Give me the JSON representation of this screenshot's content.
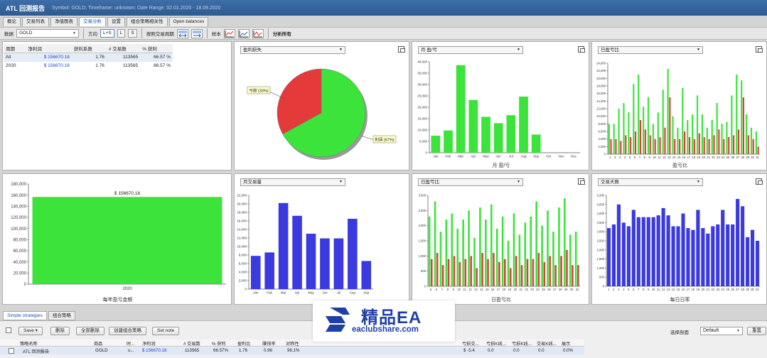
{
  "window": {
    "app_title": "ATL 回测报告",
    "subtitle": "Symbol: GOLD; Timeframe: unknown; Date Range: 02.01.2020 - 18.09.2020"
  },
  "tabs": [
    "概论",
    "交易列表",
    "净值图表",
    "交易分析",
    "设置",
    "组合策略相关性",
    "Open balances"
  ],
  "active_tab": "交易分析",
  "toolbar": {
    "data_label": "数据",
    "data_value": "GOLD",
    "direction_label": "方向",
    "direction_options": [
      "L+S",
      "L",
      "S"
    ],
    "by_period_label": "按照交易周期",
    "sample_label": "样本",
    "analysis_label": "分析所有"
  },
  "stats_table": {
    "headers": [
      "周期",
      "净利润",
      "获利系数",
      "# 交易数",
      "% 获利"
    ],
    "rows": [
      [
        "All",
        "$ 156670.18",
        "1.76",
        "113565",
        "66.57 %"
      ],
      [
        "2020",
        "$ 156670.18",
        "1.76",
        "113565",
        "66.57 %"
      ]
    ]
  },
  "panels": {
    "pie": {
      "selector": "盈利损失",
      "label_loss": "亏损 (33%)",
      "label_win": "利润 (67%)"
    },
    "monthly_profit": {
      "selector": "月 盈/亏",
      "title": "月 盈/亏"
    },
    "daily_profit_top": {
      "selector": "日盈亏比",
      "title": "盈亏比"
    },
    "yearly": {
      "value_label": "$ 156670.18",
      "title": "每年盈亏金额"
    },
    "monthly_trades": {
      "selector": "月交易量"
    },
    "daily_profit_bottom": {
      "selector": "日盈亏比",
      "title": "日盈亏比"
    },
    "trade_days": {
      "selector": "交易天数",
      "title": "每日日率"
    }
  },
  "chart_data": [
    {
      "type": "pie",
      "categories": [
        "亏损",
        "利润"
      ],
      "values": [
        33,
        67
      ],
      "colors": [
        "#e53a3a",
        "#3be33b"
      ]
    },
    {
      "type": "bar",
      "categories": [
        "Jan",
        "Feb",
        "Mar",
        "Apr",
        "May",
        "Jun",
        "Jul",
        "Aug",
        "Sep",
        "Oct",
        "Nov",
        "Dec"
      ],
      "values": [
        7500,
        9800,
        38500,
        23200,
        15800,
        13000,
        16500,
        24700,
        8000,
        0,
        0,
        0
      ],
      "ylim": [
        0,
        40000
      ],
      "yticks": [
        "0",
        "5,000",
        "10,000",
        "15,000",
        "20,000",
        "25,000",
        "30,000",
        "35,000",
        "40,000"
      ],
      "color": "#3be33b"
    },
    {
      "type": "bar",
      "categories": [
        "1",
        "2",
        "3",
        "4",
        "5",
        "6",
        "7",
        "8",
        "9",
        "10",
        "11",
        "12",
        "13",
        "14",
        "15",
        "16",
        "17",
        "18",
        "19",
        "20",
        "21",
        "22",
        "23",
        "24",
        "25",
        "26",
        "27",
        "28",
        "29",
        "30",
        "31"
      ],
      "series": [
        {
          "values": [
            8000,
            8000,
            12000,
            13500,
            11000,
            18500,
            21000,
            12500,
            15000,
            8000,
            11000,
            17000,
            22500,
            10000,
            7000,
            17500,
            9000,
            10500,
            15500,
            10500,
            7000,
            9000,
            13500,
            8000,
            8500,
            15500,
            21000,
            19500,
            10500,
            7000,
            6000
          ],
          "color": "#3be33b"
        },
        {
          "values": [
            4000,
            4000,
            3500,
            5000,
            4500,
            6000,
            9000,
            6500,
            5000,
            4000,
            4500,
            7000,
            15000,
            4000,
            4000,
            6000,
            4500,
            4000,
            5500,
            4500,
            4000,
            5000,
            6500,
            4000,
            4500,
            5000,
            6500,
            15000,
            5000,
            4000,
            2000
          ],
          "color": "#d84040"
        }
      ],
      "ylim": [
        0,
        24000
      ],
      "yticks": [
        "0",
        "2,000",
        "4,000",
        "6,000",
        "8,000",
        "10,000",
        "12,000",
        "14,000",
        "16,000",
        "18,000",
        "20,000",
        "22,000",
        "24,000"
      ]
    },
    {
      "type": "bar",
      "categories": [
        "2020"
      ],
      "values": [
        156670.18
      ],
      "ylim": [
        0,
        180000
      ],
      "yticks": [
        "0",
        "20,000",
        "40,000",
        "60,000",
        "80,000",
        "100,000",
        "120,000",
        "140,000",
        "160,000",
        "180,000"
      ],
      "color": "#3be33b"
    },
    {
      "type": "bar",
      "categories": [
        "Jan",
        "Feb",
        "Mar",
        "Apr",
        "May",
        "Jun",
        "Jul",
        "Aug",
        "Sep"
      ],
      "values": [
        7800,
        8600,
        20200,
        17200,
        13000,
        11900,
        11900,
        16500,
        6600
      ],
      "ylim": [
        0,
        22000
      ],
      "yticks": [
        "0",
        "2,000",
        "4,000",
        "6,000",
        "8,000",
        "10,000",
        "12,000",
        "14,000",
        "16,000",
        "18,000",
        "20,000",
        "22,000"
      ],
      "color": "#3a3ae0"
    },
    {
      "type": "bar",
      "categories": [
        "5",
        "6",
        "7",
        "8",
        "9",
        "10",
        "11",
        "12",
        "13",
        "14",
        "15",
        "16",
        "17",
        "18",
        "19",
        "20",
        "21",
        "22",
        "23",
        "24",
        "25",
        "26",
        "27",
        "28",
        "29",
        "30",
        "31"
      ],
      "series": [
        {
          "values": [
            2300,
            2800,
            1800,
            2200,
            2400,
            1900,
            2200,
            2500,
            1600,
            2600,
            2200,
            2700,
            1900,
            2300,
            1500,
            2400,
            1700,
            2100,
            2300,
            2800,
            2000,
            2500,
            1800,
            2600,
            2900,
            1700,
            1800
          ],
          "color": "#3be33b"
        },
        {
          "values": [
            900,
            1100,
            700,
            900,
            1000,
            800,
            900,
            1000,
            600,
            1100,
            900,
            1100,
            800,
            900,
            600,
            1000,
            700,
            900,
            900,
            1100,
            800,
            1000,
            700,
            1000,
            1200,
            700,
            700
          ],
          "color": "#d84040"
        }
      ],
      "ylim": [
        0,
        3000
      ],
      "yticks": [
        "0",
        "500",
        "1,000",
        "1,500",
        "2,000",
        "2,500",
        "3,000"
      ]
    },
    {
      "type": "bar",
      "categories": [
        "1",
        "2",
        "3",
        "4",
        "5",
        "6",
        "7",
        "8",
        "9",
        "10",
        "11",
        "12",
        "13",
        "14",
        "15",
        "16",
        "17",
        "18",
        "19",
        "20",
        "21",
        "22",
        "23",
        "24",
        "25",
        "26",
        "27",
        "28",
        "29",
        "30",
        "31"
      ],
      "values": [
        3200,
        3400,
        4500,
        3500,
        3300,
        4200,
        3800,
        3800,
        3800,
        3800,
        3900,
        4300,
        3900,
        3300,
        3300,
        4000,
        3200,
        3100,
        4200,
        3200,
        2900,
        3300,
        3400,
        4200,
        3400,
        3400,
        4800,
        4400,
        2700,
        3100,
        2500
      ],
      "ylim": [
        0,
        5000
      ],
      "yticks": [
        "0",
        "500",
        "1,000",
        "1,500",
        "2,000",
        "2,500",
        "3,000",
        "3,500",
        "4,000",
        "4,500",
        "5,000"
      ],
      "color": "#3a3ae0"
    }
  ],
  "bottom": {
    "tabs": [
      "Simple strategies",
      "组合策略"
    ],
    "buttons": [
      "Save ▾",
      "删除",
      "全部删除",
      "创建组合策略",
      "Set note"
    ],
    "select_label": "选择剖面",
    "select_value": "Default",
    "apply_button": "重置",
    "grid_headers": [
      "策略名称",
      "商品",
      "时...",
      "净利润",
      "# 交易数",
      "% 获利",
      "盈利比",
      "赚钱率",
      "对称性",
      "亏损交...",
      "亏损K线...",
      "亏损K线...",
      "交易K线...",
      "展示"
    ],
    "grid_row": [
      "ATL 回测报告",
      "GOLD",
      "u...",
      "$ 156670.18",
      "113565",
      "66.57%",
      "1.76",
      "0.96",
      "96.1%",
      "$ -5.4",
      "0.0",
      "0.0",
      "0.0",
      "0.0%"
    ]
  },
  "watermark": {
    "brand": "精品EA",
    "url": "eaclubshare.com"
  }
}
